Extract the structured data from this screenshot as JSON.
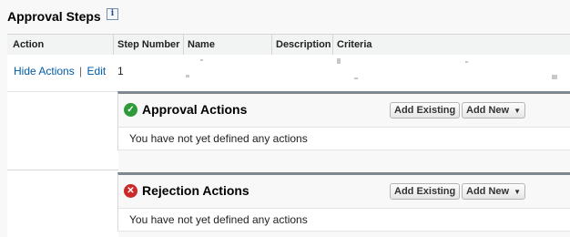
{
  "section": {
    "title": "Approval Steps",
    "info_icon": "info-icon"
  },
  "table": {
    "columns": [
      "Action",
      "Step Number",
      "Name",
      "Description",
      "Criteria"
    ],
    "row": {
      "hide_actions": "Hide Actions",
      "separator": "|",
      "edit": "Edit",
      "step_number": "1"
    }
  },
  "approval_actions": {
    "title": "Approval Actions",
    "add_existing": "Add Existing",
    "add_new": "Add New",
    "empty_message": "You have not yet defined any actions",
    "icon": "check-circle-icon",
    "icon_color": "#2e9a3a"
  },
  "rejection_actions": {
    "title": "Rejection Actions",
    "add_existing": "Add Existing",
    "add_new": "Add New",
    "empty_message": "You have not yet defined any actions",
    "icon": "x-circle-icon",
    "icon_color": "#cc2a2a"
  },
  "colors": {
    "link": "#015ba7",
    "panel_border": "#7f8791"
  }
}
